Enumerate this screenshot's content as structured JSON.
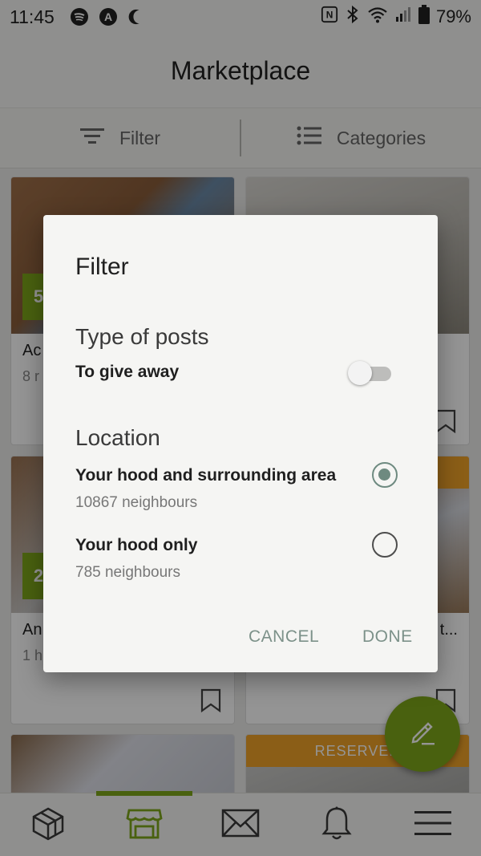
{
  "status_bar": {
    "time": "11:45",
    "battery": "79%",
    "icons": [
      "spotify-icon",
      "a-icon",
      "moon-icon",
      "nfc-icon",
      "bluetooth-icon",
      "wifi-icon",
      "signal-icon",
      "battery-icon"
    ]
  },
  "app_bar": {
    "title": "Marketplace"
  },
  "filter_bar": {
    "filter_label": "Filter",
    "categories_label": "Categories"
  },
  "cards": [
    {
      "caption": "Ac",
      "sub": "8 r",
      "badge": "5"
    },
    {
      "caption": "",
      "sub": ""
    },
    {
      "caption": "An",
      "sub": "1 h",
      "badge": "2"
    },
    {
      "caption": "t...",
      "sub": ""
    },
    {
      "caption": "",
      "sub": ""
    },
    {
      "caption": "",
      "sub": "",
      "strip": "RESERVED"
    }
  ],
  "dialog": {
    "title": "Filter",
    "type_section": "Type of posts",
    "give_away_label": "To give away",
    "give_away_enabled": false,
    "location_section": "Location",
    "options": [
      {
        "label": "Your hood and surrounding area",
        "sub": "10867 neighbours",
        "selected": true
      },
      {
        "label": "Your hood only",
        "sub": "785 neighbours",
        "selected": false
      }
    ],
    "cancel_label": "CANCEL",
    "done_label": "DONE"
  },
  "colors": {
    "accent_green": "#7fa81b",
    "orange": "#f0a328",
    "dialog_button": "#7c9189",
    "radio_selected": "#6e8a80"
  },
  "bottom_nav": {
    "items": [
      "home-icon",
      "marketplace-icon",
      "messages-icon",
      "notifications-icon",
      "menu-icon"
    ],
    "active_index": 1
  }
}
